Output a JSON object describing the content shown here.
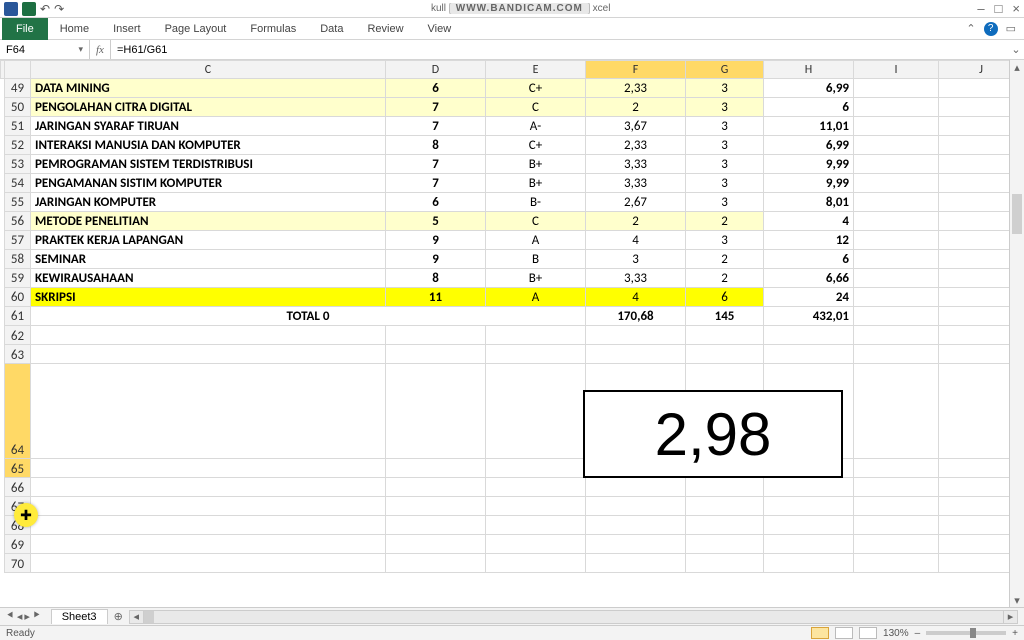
{
  "window": {
    "title_left": "kull",
    "title_right": "xcel",
    "watermark": "WWW.BANDICAM.COM"
  },
  "qat": {
    "undo": "↶",
    "redo": "↷"
  },
  "winbuttons": {
    "min": "–",
    "max": "□",
    "close": "×"
  },
  "ribbon": {
    "file": "File",
    "tabs": [
      "Home",
      "Insert",
      "Page Layout",
      "Formulas",
      "Data",
      "Review",
      "View"
    ],
    "collapse": "⌃"
  },
  "formula_bar": {
    "namebox": "F64",
    "fx": "fx",
    "formula": "=H61/G61",
    "expand": "⌄"
  },
  "columns": [
    "C",
    "D",
    "E",
    "F",
    "G",
    "H",
    "I",
    "J"
  ],
  "selected_col_indexes": [
    3,
    4
  ],
  "rows": [
    {
      "n": 49,
      "hl": "cream",
      "c": "DATA MINING",
      "d": "6",
      "e": "C+",
      "f": "2,33",
      "g": "3",
      "h": "6,99"
    },
    {
      "n": 50,
      "hl": "cream",
      "c": "PENGOLAHAN CITRA DIGITAL",
      "d": "7",
      "e": "C",
      "f": "2",
      "g": "3",
      "h": "6"
    },
    {
      "n": 51,
      "hl": "",
      "c": "JARINGAN SYARAF TIRUAN",
      "d": "7",
      "e": "A-",
      "f": "3,67",
      "g": "3",
      "h": "11,01"
    },
    {
      "n": 52,
      "hl": "",
      "c": "INTERAKSI MANUSIA DAN KOMPUTER",
      "d": "8",
      "e": "C+",
      "f": "2,33",
      "g": "3",
      "h": "6,99"
    },
    {
      "n": 53,
      "hl": "",
      "c": "PEMROGRAMAN SISTEM TERDISTRIBUSI",
      "d": "7",
      "e": "B+",
      "f": "3,33",
      "g": "3",
      "h": "9,99"
    },
    {
      "n": 54,
      "hl": "",
      "c": "PENGAMANAN SISTIM KOMPUTER",
      "d": "7",
      "e": "B+",
      "f": "3,33",
      "g": "3",
      "h": "9,99"
    },
    {
      "n": 55,
      "hl": "",
      "c": "JARINGAN KOMPUTER",
      "d": "6",
      "e": "B-",
      "f": "2,67",
      "g": "3",
      "h": "8,01"
    },
    {
      "n": 56,
      "hl": "cream",
      "c": "METODE PENELITIAN",
      "d": "5",
      "e": "C",
      "f": "2",
      "g": "2",
      "h": "4"
    },
    {
      "n": 57,
      "hl": "",
      "c": "PRAKTEK KERJA LAPANGAN",
      "d": "9",
      "e": "A",
      "f": "4",
      "g": "3",
      "h": "12"
    },
    {
      "n": 58,
      "hl": "",
      "c": "SEMINAR",
      "d": "9",
      "e": "B",
      "f": "3",
      "g": "2",
      "h": "6"
    },
    {
      "n": 59,
      "hl": "",
      "c": "KEWIRAUSAHAAN",
      "d": "8",
      "e": "B+",
      "f": "3,33",
      "g": "2",
      "h": "6,66"
    },
    {
      "n": 60,
      "hl": "yellow",
      "c": "SKRIPSI",
      "d": "11",
      "e": "A",
      "f": "4",
      "g": "6",
      "h": "24"
    }
  ],
  "totals": {
    "row": 61,
    "label": "TOTAL 0",
    "f": "170,68",
    "g": "145",
    "h": "432,01"
  },
  "empty_rows": [
    62,
    63,
    64,
    65,
    66,
    67,
    68,
    69,
    70
  ],
  "selected_rows_highlight": [
    64,
    65
  ],
  "big_result": {
    "value": "2,98"
  },
  "sheet_tabs": {
    "nav_first": "⯇",
    "nav_prev": "◂",
    "nav_next": "▸",
    "nav_last": "⯈",
    "active": "Sheet3",
    "add": "⊕"
  },
  "statusbar": {
    "ready": "Ready",
    "zoom": "130%",
    "plus": "+",
    "minus": "–"
  },
  "cursor_glyph": "✚"
}
